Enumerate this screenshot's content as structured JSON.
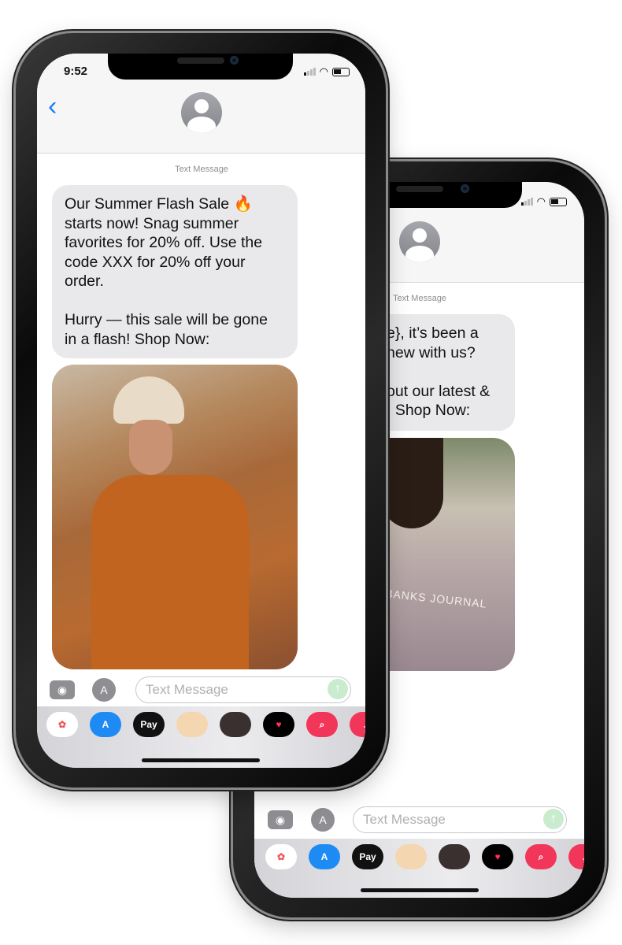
{
  "front": {
    "time": "9:52",
    "label": "Text Message",
    "message": "Our Summer Flash Sale 🔥\nstarts now! Snag summer\nfavorites for 20% off. Use the\ncode XXX for 20% off your\norder.\n\nHurry — this sale will be gone\nin a flash! Shop Now:",
    "input_placeholder": "Text Message"
  },
  "back": {
    "label": "Text Message",
    "message": "e}, it’s been a\nnew with us?\n\nout our latest &\n. Shop Now:",
    "shirt_text": "BANKS JOURNAL",
    "input_placeholder": "Text Message"
  },
  "apps": [
    {
      "icon": "photos-icon"
    },
    {
      "icon": "app-store-icon"
    },
    {
      "icon": "apple-pay-icon",
      "label": "Pay"
    },
    {
      "icon": "memoji-stickers-icon"
    },
    {
      "icon": "animoji-icon"
    },
    {
      "icon": "digital-touch-icon"
    },
    {
      "icon": "web-image-search-icon"
    },
    {
      "icon": "music-icon"
    }
  ],
  "colors": {
    "accent": "#1a7ef7",
    "bubble": "#e9e9eb"
  }
}
